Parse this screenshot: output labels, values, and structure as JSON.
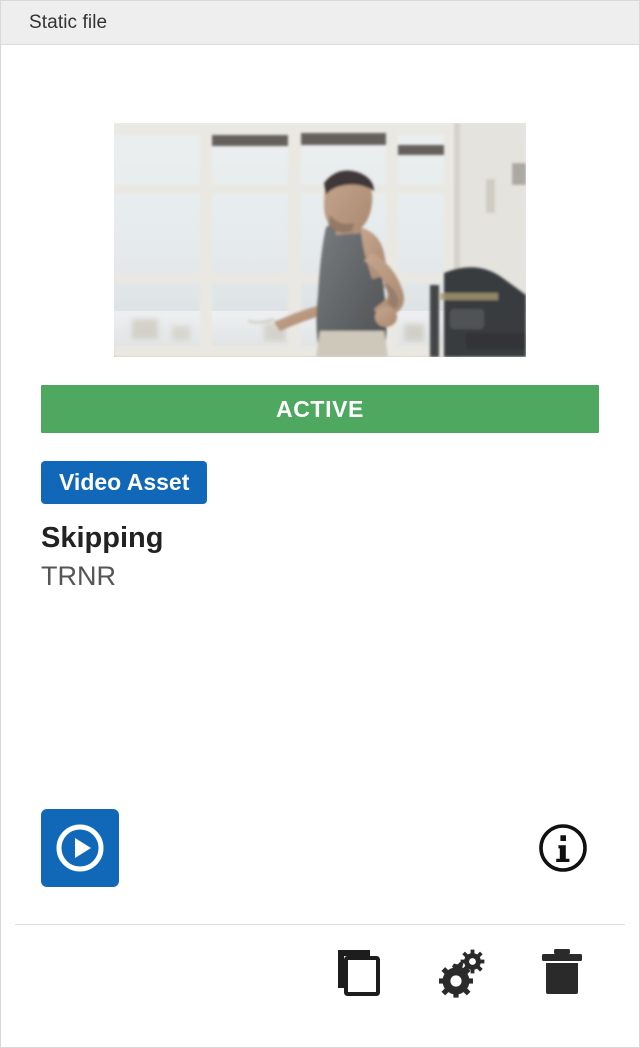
{
  "window": {
    "title": "Static file"
  },
  "asset": {
    "status_label": "ACTIVE",
    "status_color": "#4EA85F",
    "type_label": "Video Asset",
    "type_color": "#1168B8",
    "title": "Skipping",
    "subtitle": "TRNR",
    "thumbnail_alt": "Man skipping rope in a gym in front of tall windows"
  },
  "actions": {
    "play": {
      "icon": "play-circle-icon",
      "color": "#1168B8"
    },
    "info": {
      "icon": "info-circle-icon",
      "color": "#111111"
    }
  },
  "footer": {
    "icons": [
      {
        "name": "copy-icon",
        "color": "#1d1d1d"
      },
      {
        "name": "settings-gears-icon",
        "color": "#2a2a2a"
      },
      {
        "name": "trash-icon",
        "color": "#2a2a2a"
      }
    ]
  }
}
